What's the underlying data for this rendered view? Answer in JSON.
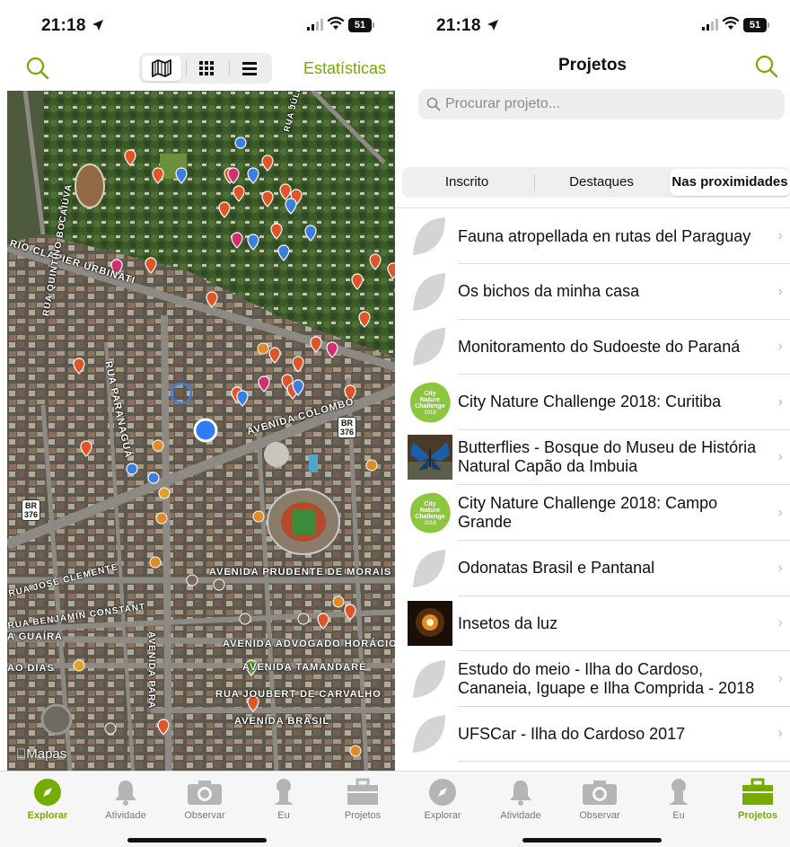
{
  "status_left": {
    "time": "21:18",
    "battery": "51"
  },
  "status_right": {
    "time": "21:18",
    "battery": "51"
  },
  "explore": {
    "view_modes": [
      "map-icon",
      "grid-icon",
      "list-icon"
    ],
    "active_view": "map",
    "stats_label": "Estatísticas",
    "map": {
      "credit": "Mapas",
      "roads": [
        "AVENIDA COLOMBO",
        "RUA PARANAGUÁ",
        "RIO CLAPIER URBINATI",
        "AVENIDA PRUDENTE DE MORAIS",
        "AVENIDA ADVOGADO HORÁCIO",
        "AVENIDA TAMANDARÉ",
        "RUA JOUBERT DE CARVALHO",
        "AVENIDA BRASIL",
        "RUA QUINTINO BOCAIÚVA",
        "RUA BENJAMIN CONSTANT",
        "RUA JOSÉ CLEMENTE",
        "A GUAÍRA",
        "AO DIAS",
        "RUA JÚLIO FAVO",
        "AVENIDA PARA"
      ],
      "shields": [
        {
          "line1": "BR",
          "line2": "376"
        },
        {
          "line1": "BR",
          "line2": "376"
        }
      ]
    }
  },
  "tabs_left": [
    {
      "label": "Explorar",
      "icon": "compass-icon",
      "active": true
    },
    {
      "label": "Atividade",
      "icon": "bell-icon",
      "active": false
    },
    {
      "label": "Observar",
      "icon": "camera-icon",
      "active": false
    },
    {
      "label": "Eu",
      "icon": "person-icon",
      "active": false
    },
    {
      "label": "Projetos",
      "icon": "briefcase-icon",
      "active": false
    }
  ],
  "projects": {
    "title": "Projetos",
    "search_placeholder": "Procurar projeto...",
    "tabs": [
      "Inscrito",
      "Destaques",
      "Nas proximidades"
    ],
    "active_tab": "Nas proximidades",
    "items": [
      {
        "title": "Fauna atropellada en rutas del Paraguay",
        "thumb": "leaf"
      },
      {
        "title": "Os bichos da minha casa",
        "thumb": "leaf"
      },
      {
        "title": "Monitoramento do Sudoeste do Paraná",
        "thumb": "leaf"
      },
      {
        "title": "City Nature Challenge 2018: Curitiba",
        "thumb": "cnc"
      },
      {
        "title": "Butterflies - Bosque do Museu de História Natural Capão da Imbuia",
        "thumb": "butterfly"
      },
      {
        "title": "City Nature Challenge 2018: Campo Grande",
        "thumb": "cnc"
      },
      {
        "title": "Odonatas Brasil e Pantanal",
        "thumb": "leaf"
      },
      {
        "title": "Insetos da luz",
        "thumb": "light"
      },
      {
        "title": "Estudo do meio - Ilha do Cardoso, Cananeia, Iguape e Ilha Comprida - 2018",
        "thumb": "leaf"
      },
      {
        "title": "UFSCar - Ilha do Cardoso 2017",
        "thumb": "leaf"
      }
    ],
    "cnc_badge": {
      "line1": "City",
      "line2": "Nature",
      "line3": "Challenge",
      "line4": "2018"
    }
  },
  "tabs_right": [
    {
      "label": "Explorar",
      "icon": "compass-icon",
      "active": false
    },
    {
      "label": "Atividade",
      "icon": "bell-icon",
      "active": false
    },
    {
      "label": "Observar",
      "icon": "camera-icon",
      "active": false
    },
    {
      "label": "Eu",
      "icon": "person-icon",
      "active": false
    },
    {
      "label": "Projetos",
      "icon": "briefcase-icon",
      "active": true
    }
  ],
  "colors": {
    "accent": "#74ac00",
    "pin_orange": "#e0542a",
    "pin_magenta": "#d1306e",
    "pin_blue": "#3b7de0",
    "pin_green": "#6bb33a"
  }
}
